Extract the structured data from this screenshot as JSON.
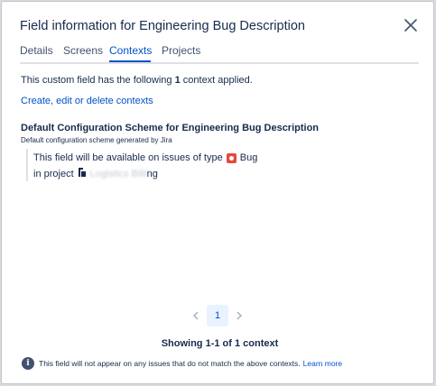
{
  "dialog": {
    "title": "Field information for Engineering Bug Description",
    "close_icon": "close-icon"
  },
  "tabs": [
    {
      "label": "Details"
    },
    {
      "label": "Screens"
    },
    {
      "label": "Contexts",
      "active": true
    },
    {
      "label": "Projects"
    }
  ],
  "contexts": {
    "intro_prefix": "This custom field has the following ",
    "count": "1",
    "intro_suffix": " context applied.",
    "manage_link": "Create, edit or delete contexts",
    "scheme_name": "Default Configuration Scheme for Engineering Bug Description",
    "scheme_description": "Default configuration scheme generated by Jira",
    "issue_type_text": "This field will be available on issues of type",
    "issue_type": "Bug",
    "project_prefix": "in project",
    "project_name": "Logistics Billi",
    "project_suffix": "ng"
  },
  "pagination": {
    "current_page": "1",
    "showing_text": "Showing 1-1 of 1 context"
  },
  "footer": {
    "note": "This field will not appear on any issues that do not match the above contexts.",
    "learn_more": "Learn more"
  },
  "colors": {
    "accent": "#0052cc",
    "bug": "#e5493a",
    "text": "#172b4d"
  }
}
